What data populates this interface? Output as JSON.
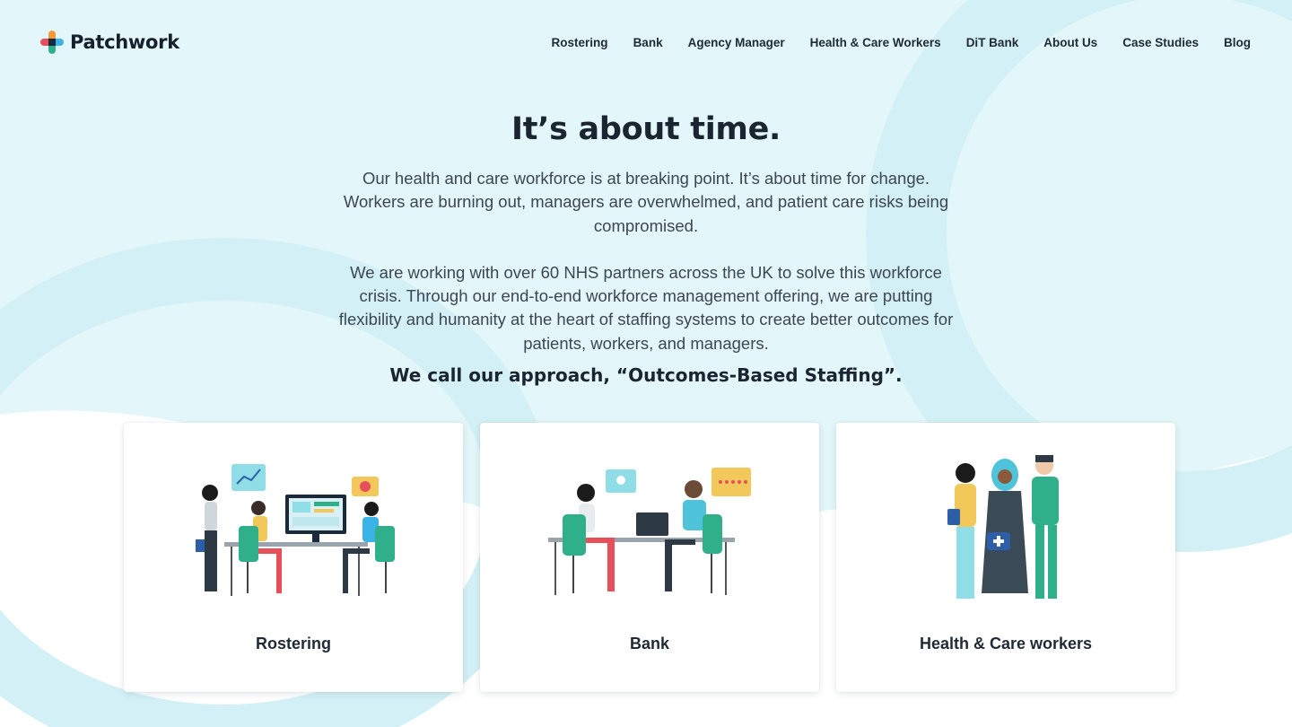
{
  "brand": {
    "name": "Patchwork",
    "logo_icon": "patchwork-cross-logo"
  },
  "nav": {
    "items": [
      {
        "label": "Rostering"
      },
      {
        "label": "Bank"
      },
      {
        "label": "Agency Manager"
      },
      {
        "label": "Health & Care Workers"
      },
      {
        "label": "DiT Bank"
      },
      {
        "label": "About Us"
      },
      {
        "label": "Case Studies"
      },
      {
        "label": "Blog"
      }
    ]
  },
  "hero": {
    "title": "It’s about time.",
    "paragraph_1": "Our health and care workforce is at breaking point. It’s about time for change. Workers are burning out, managers are overwhelmed, and patient care risks being compromised.",
    "paragraph_2": "We are working with over 60 NHS partners across the UK to solve this workforce crisis. Through our end-to-end workforce management offering, we are putting flexibility and humanity at the heart of staffing systems to create better outcomes for patients, workers, and managers.",
    "approach": "We call our approach, “Outcomes-Based Staffing”."
  },
  "cards": [
    {
      "label": "Rostering",
      "illustration": "team-at-computer-illustration"
    },
    {
      "label": "Bank",
      "illustration": "desk-meeting-illustration"
    },
    {
      "label": "Health & Care workers",
      "illustration": "healthcare-workers-illustration"
    }
  ],
  "colors": {
    "background_tint": "#e3f6f9",
    "background_arc": "#d2f0f5",
    "text_dark": "#1b2531",
    "text_body": "#3d4651",
    "accent_green": "#2fb08a",
    "accent_yellow": "#f2c85b",
    "accent_blue": "#2d5fa8"
  }
}
